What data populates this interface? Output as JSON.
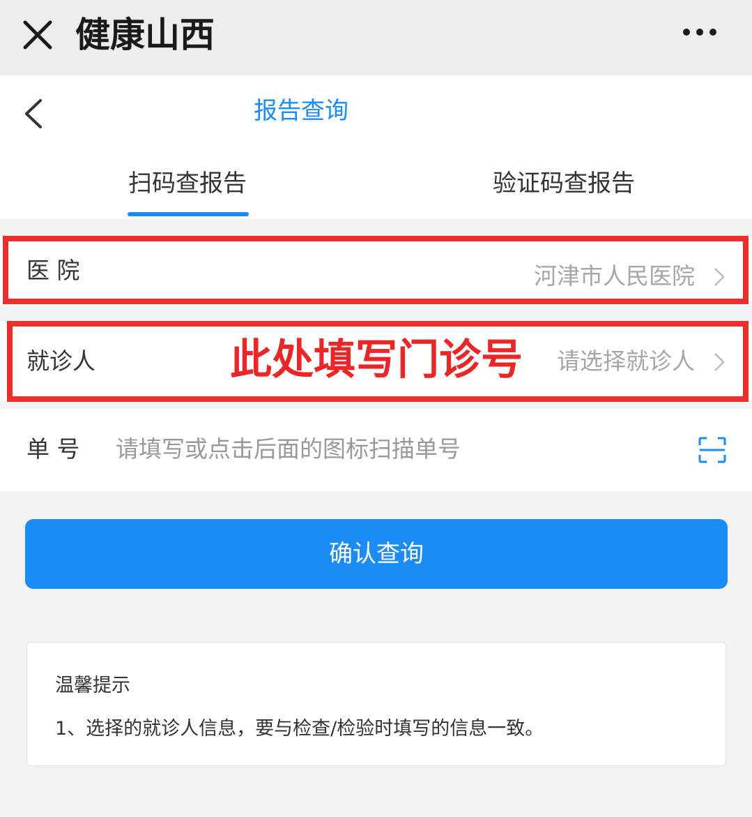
{
  "window": {
    "title": "健康山西",
    "close_icon": "close-icon",
    "more_icon": "more-dots-icon"
  },
  "nav": {
    "title": "报告查询",
    "back_icon": "back-chevron-icon"
  },
  "tabs": [
    {
      "label": "扫码查报告",
      "active": true
    },
    {
      "label": "验证码查报告",
      "active": false
    }
  ],
  "form": {
    "hospital": {
      "label": "医  院",
      "value": "河津市人民医院"
    },
    "patient": {
      "label": "就诊人",
      "placeholder": "请选择就诊人"
    },
    "order": {
      "label": "单  号",
      "placeholder": "请填写或点击后面的图标扫描单号",
      "scan_icon": "scan-icon"
    }
  },
  "annotation": {
    "text": "此处填写门诊号",
    "color": "#ea2626"
  },
  "confirm_button": {
    "label": "确认查询"
  },
  "tips": {
    "title": "温馨提示",
    "items": [
      "1、选择的就诊人信息，要与检查/检验时填写的信息一致。"
    ]
  },
  "colors": {
    "accent": "#1b8cf5",
    "annotation_border": "#ee2d2d",
    "placeholder": "#a6a6a6"
  }
}
